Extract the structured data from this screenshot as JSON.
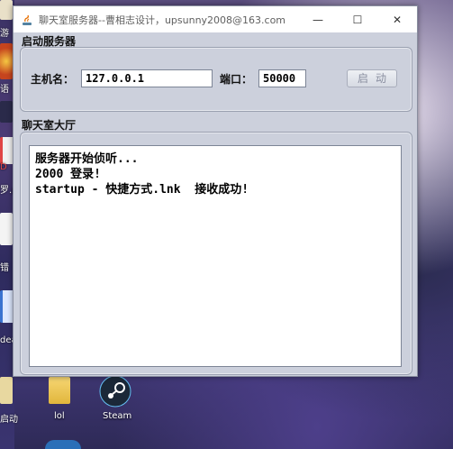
{
  "window": {
    "title": "聊天室服务器--曹相志设计，upsunny2008@163.com",
    "controls": {
      "minimize": "—",
      "maximize": "☐",
      "close": "✕"
    }
  },
  "server_group": {
    "label": "启动服务器",
    "host_label": "主机名：",
    "host_value": "127.0.0.1",
    "port_label": "端口：",
    "port_value": "50000",
    "start_button": "启动"
  },
  "lobby_group": {
    "label": "聊天室大厅",
    "lines": [
      "服务器开始侦听...",
      "2000 登录!",
      "startup - 快捷方式.lnk  接收成功!"
    ]
  },
  "desktop": {
    "side_texts": [
      "游",
      "语",
      "D",
      "罗.p",
      "错",
      "dea",
      "启动"
    ],
    "icons": [
      "lol",
      "Steam"
    ]
  },
  "colors": {
    "window_bg": "#ccd0dc",
    "accent_border": "#9aa0b0"
  }
}
